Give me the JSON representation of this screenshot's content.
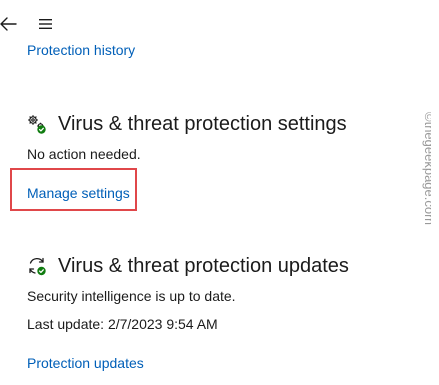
{
  "nav": {
    "back_icon": "arrow-left-icon",
    "menu_icon": "hamburger-menu-icon"
  },
  "history_link": "Protection history",
  "settings_section": {
    "icon": "gears-icon",
    "title": "Virus & threat protection settings",
    "status": "No action needed.",
    "manage_link": "Manage settings"
  },
  "updates_section": {
    "icon": "refresh-icon",
    "title": "Virus & threat protection updates",
    "status": "Security intelligence is up to date.",
    "last_update": "Last update: 2/7/2023 9:54 AM",
    "updates_link": "Protection updates"
  },
  "watermark": "©thegeekpage.com",
  "colors": {
    "link": "#005fb8",
    "text": "#1b1b1b",
    "highlight": "#e0474a",
    "status_ok": "#107c10"
  }
}
